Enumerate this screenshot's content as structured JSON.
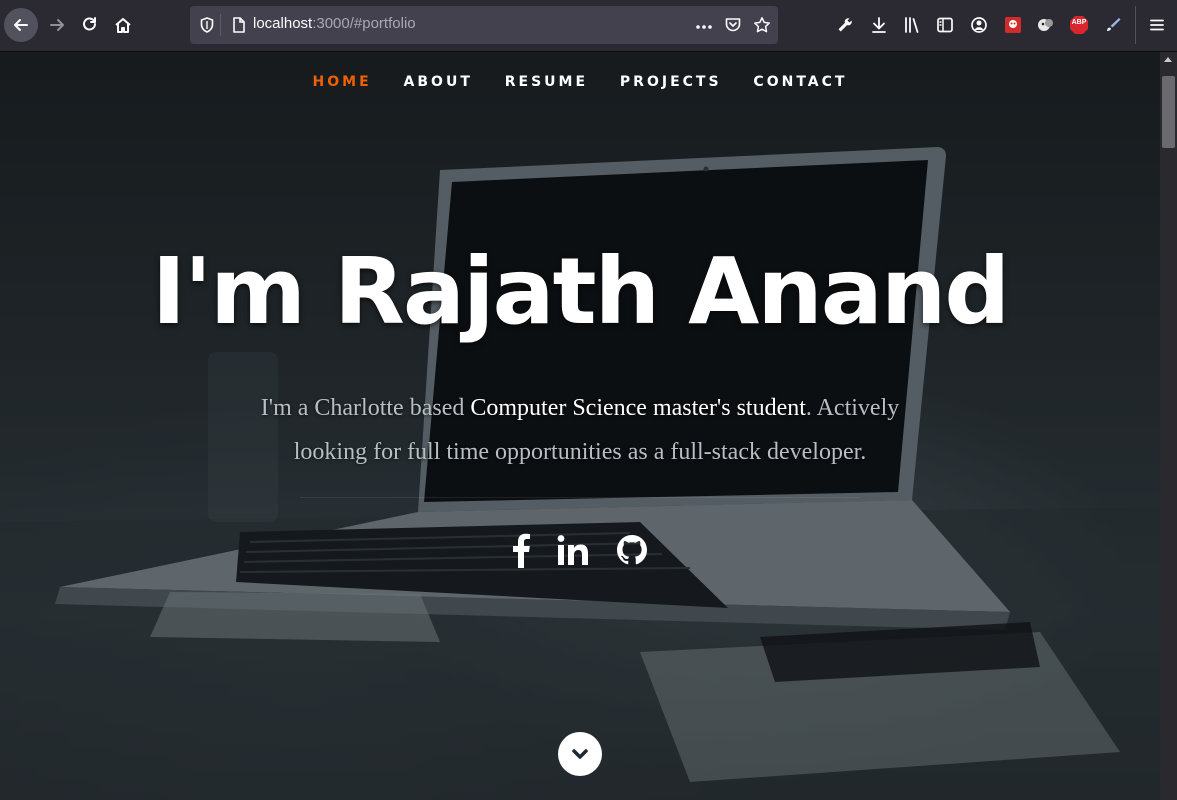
{
  "browser": {
    "url_host": "localhost",
    "url_rest": ":3000/#portfolio",
    "page_actions_icon": "ellipsis-icon"
  },
  "nav": {
    "items": [
      {
        "label": "HOME",
        "active": true
      },
      {
        "label": "ABOUT",
        "active": false
      },
      {
        "label": "RESUME",
        "active": false
      },
      {
        "label": "PROJECTS",
        "active": false
      },
      {
        "label": "CONTACT",
        "active": false
      }
    ],
    "active_color": "#f06000"
  },
  "hero": {
    "headline": "I'm Rajath Anand",
    "intro_before": "I'm a Charlotte based ",
    "intro_highlight": "Computer Science master's student",
    "intro_after": ". Actively looking for full time opportunities as a full-stack developer."
  },
  "social": [
    {
      "name": "facebook-icon"
    },
    {
      "name": "linkedin-icon"
    },
    {
      "name": "github-icon"
    }
  ],
  "extensions": {
    "abp_label": "ABP"
  }
}
